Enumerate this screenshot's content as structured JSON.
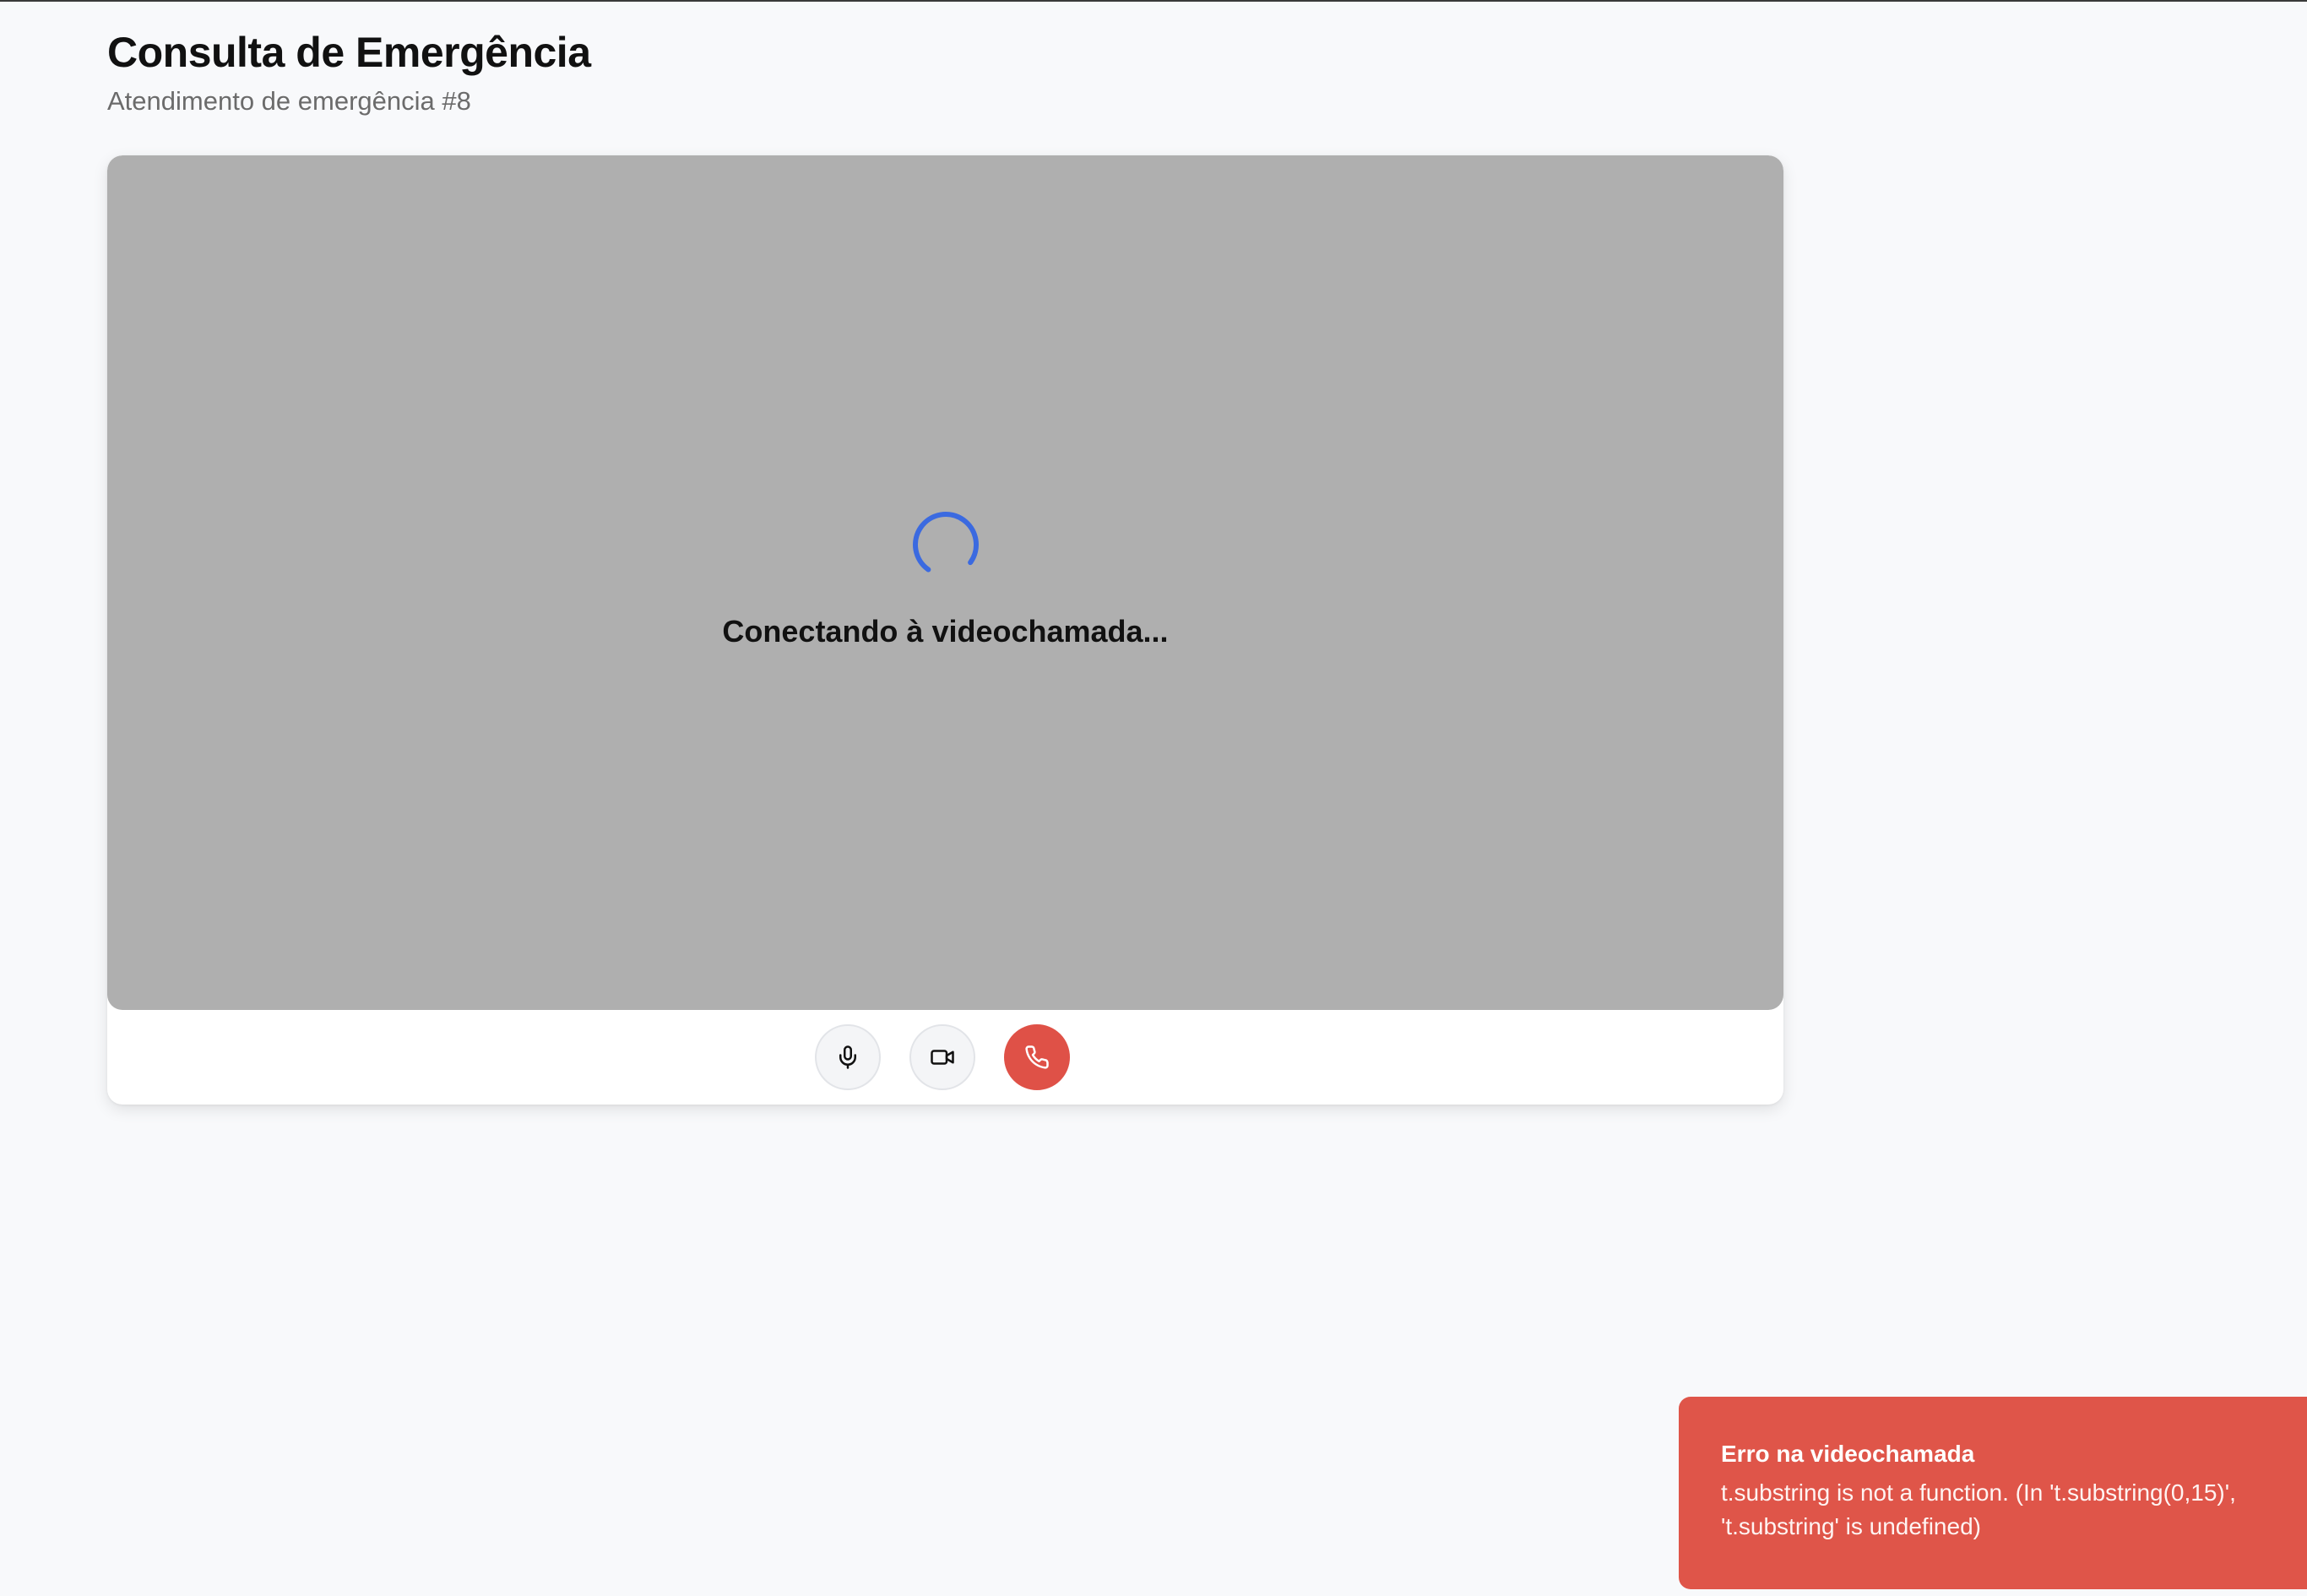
{
  "header": {
    "title": "Consulta de Emergência",
    "subtitle": "Atendimento de emergência #8"
  },
  "video": {
    "status_text": "Conectando à videochamada...",
    "spinner_color": "#3b6ae0",
    "background_color": "#afafaf"
  },
  "controls": {
    "mic_icon": "mic-icon",
    "camera_icon": "video-camera-icon",
    "end_call_icon": "phone-icon",
    "end_call_color": "#df5147"
  },
  "toast": {
    "title": "Erro na videochamada",
    "message": "t.substring is not a function. (In 't.substring(0,15)', 't.substring' is undefined)",
    "color": "#df5549"
  }
}
